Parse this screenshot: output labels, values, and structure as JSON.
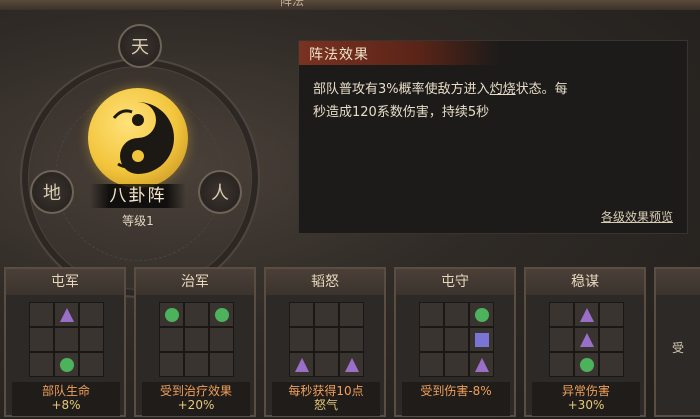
{
  "window": {
    "title": "阵法"
  },
  "formation": {
    "name": "八卦阵",
    "level": "等级1",
    "nodes": {
      "top": "天",
      "left": "地",
      "right": "人"
    },
    "emblem_icon": "yin-yang-icon"
  },
  "effect": {
    "header": "阵法效果",
    "text_line1_a": "部队普攻有3%概率使敌方进入",
    "keyword": "灼烧",
    "text_line1_b": "状态。每",
    "text_line2": "秒造成120系数伤害，持续5秒",
    "preview_link": "各级效果预览"
  },
  "colors": {
    "triangle": "#9a6fc7",
    "circle": "#4db25c",
    "square": "#7a74d4",
    "accent_orange": "#f0a05a"
  },
  "cards": [
    {
      "title": "屯军",
      "effect_label": "部队生命",
      "effect_value": "+8%",
      "marks": [
        {
          "r": 0,
          "c": 1,
          "t": "triangle"
        },
        {
          "r": 2,
          "c": 1,
          "t": "circle"
        }
      ]
    },
    {
      "title": "治军",
      "effect_label": "受到治疗效果",
      "effect_value": "+20%",
      "marks": [
        {
          "r": 0,
          "c": 0,
          "t": "circle"
        },
        {
          "r": 0,
          "c": 2,
          "t": "circle"
        }
      ]
    },
    {
      "title": "韬怒",
      "effect_label": "每秒获得10点",
      "effect_value": "怒气",
      "marks": [
        {
          "r": 2,
          "c": 0,
          "t": "triangle"
        },
        {
          "r": 2,
          "c": 2,
          "t": "triangle"
        }
      ]
    },
    {
      "title": "屯守",
      "effect_label": "受到伤害-8%",
      "effect_value": "",
      "marks": [
        {
          "r": 0,
          "c": 2,
          "t": "circle"
        },
        {
          "r": 1,
          "c": 2,
          "t": "square"
        },
        {
          "r": 2,
          "c": 2,
          "t": "triangle"
        }
      ]
    },
    {
      "title": "稳谋",
      "effect_label": "异常伤害",
      "effect_value": "+30%",
      "marks": [
        {
          "r": 0,
          "c": 1,
          "t": "triangle"
        },
        {
          "r": 1,
          "c": 1,
          "t": "triangle"
        },
        {
          "r": 2,
          "c": 1,
          "t": "circle"
        }
      ]
    },
    {
      "title": "",
      "effect_label": "受",
      "effect_value": "",
      "marks": []
    }
  ]
}
